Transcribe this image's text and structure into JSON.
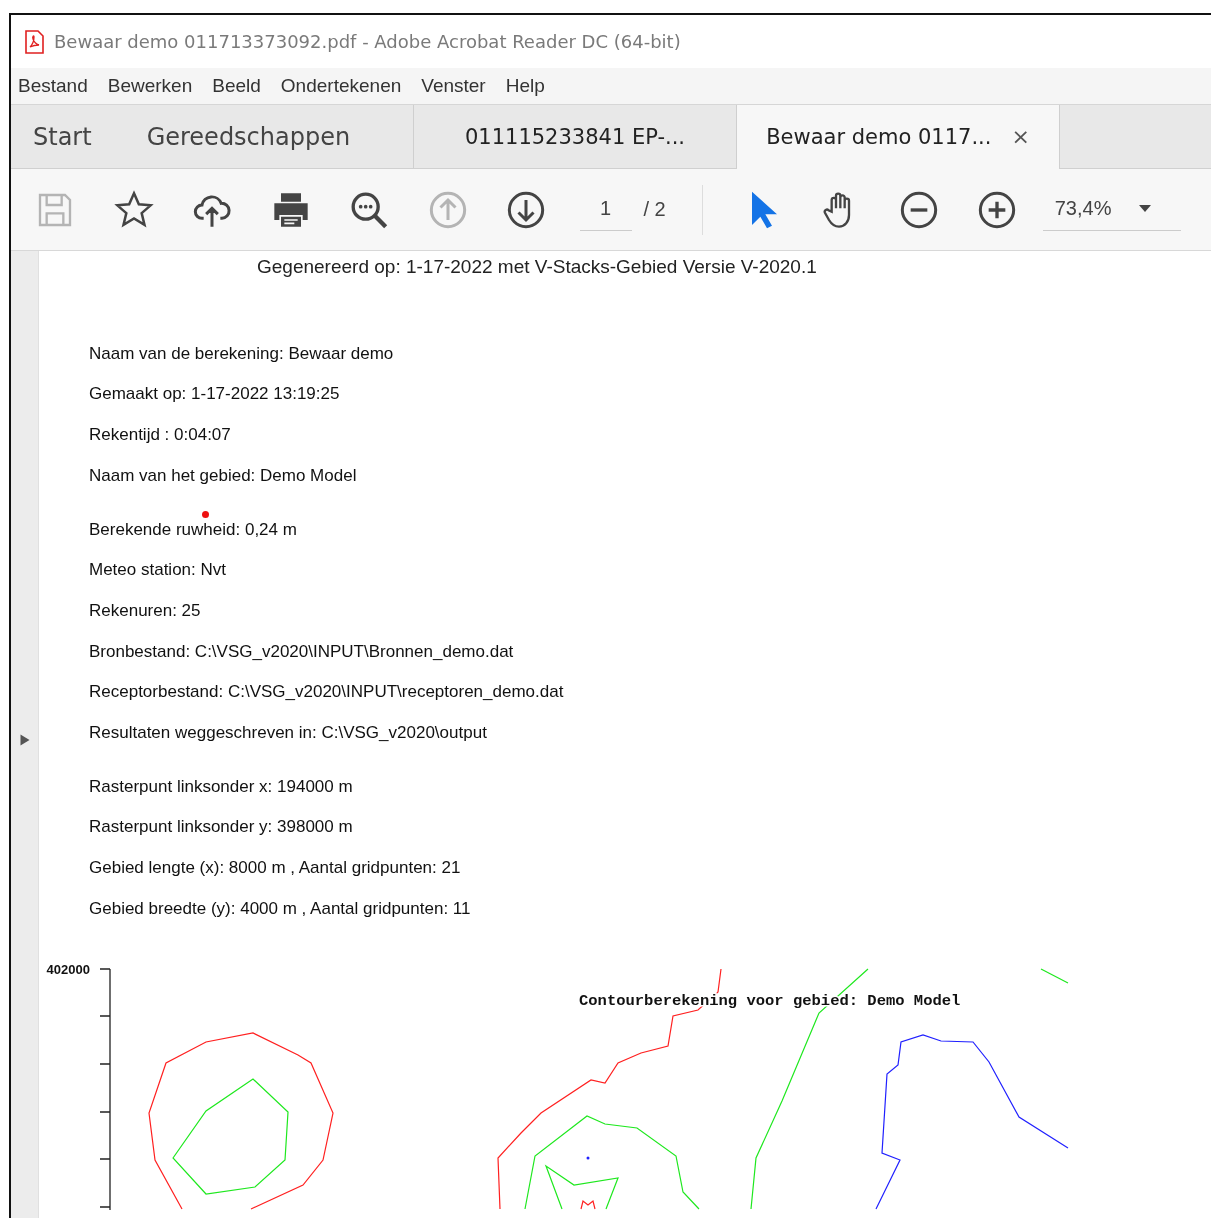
{
  "window": {
    "title": "Bewaar demo 011713373092.pdf - Adobe Acrobat Reader DC (64-bit)"
  },
  "menu": [
    "Bestand",
    "Bewerken",
    "Beeld",
    "Ondertekenen",
    "Venster",
    "Help"
  ],
  "home_tabs": [
    {
      "label": "Start",
      "selected": false
    },
    {
      "label": "Gereedschappen",
      "selected": false
    }
  ],
  "doc_tabs": [
    {
      "label": "011115233841 EP-...",
      "selected": false
    },
    {
      "label": "Bewaar demo 0117...",
      "selected": true,
      "close": "×"
    }
  ],
  "toolbar": {
    "tools": [
      {
        "kind": "save",
        "disabled": true,
        "selected": false
      },
      {
        "kind": "star",
        "disabled": false,
        "selected": false
      },
      {
        "kind": "upload",
        "disabled": false,
        "selected": false
      },
      {
        "kind": "print",
        "disabled": false,
        "selected": false
      },
      {
        "kind": "search",
        "disabled": false,
        "selected": false
      },
      {
        "kind": "prev",
        "disabled": true,
        "selected": false
      },
      {
        "kind": "next",
        "disabled": false,
        "selected": false
      },
      {
        "kind": "page"
      },
      {
        "kind": "separator"
      },
      {
        "kind": "pointer",
        "disabled": false,
        "selected": true
      },
      {
        "kind": "hand",
        "disabled": false,
        "selected": false
      },
      {
        "kind": "zoom-out",
        "disabled": false,
        "selected": false
      },
      {
        "kind": "zoom-in",
        "disabled": false,
        "selected": false
      },
      {
        "kind": "zoom"
      }
    ],
    "page_number": "1",
    "page_total": "/ 2",
    "zoom": "73,4%"
  },
  "document": {
    "header": "Gegenereerd op:  1-17-2022 met V-Stacks-Gebied Versie V-2020.1",
    "sections": [
      [
        {
          "text": "Naam van de berekening: Bewaar demo",
          "marker": false
        },
        {
          "text": "Gemaakt op: 1-17-2022   13:19:25",
          "marker": false
        },
        {
          "text": "Rekentijd :  0:04:07",
          "marker": false
        },
        {
          "text": "Naam van het gebied: Demo Model",
          "marker": false
        }
      ],
      [
        {
          "text": "Berekende ruwheid: 0,24 m",
          "marker": true
        },
        {
          "text": "Meteo station: Nvt",
          "marker": false
        },
        {
          "text": "Rekenuren: 25",
          "marker": false
        },
        {
          "text": "Bronbestand: C:\\VSG_v2020\\INPUT\\Bronnen_demo.dat",
          "marker": false
        },
        {
          "text": "Receptorbestand: C:\\VSG_v2020\\INPUT\\receptoren_demo.dat",
          "marker": false
        },
        {
          "text": "Resultaten weggeschreven in: C:\\VSG_v2020\\output",
          "marker": false
        }
      ],
      [
        {
          "text": "Rasterpunt linksonder x: 194000 m",
          "marker": false
        },
        {
          "text": "Rasterpunt linksonder y: 398000 m",
          "marker": false
        },
        {
          "text": "Gebied lengte  (x): 8000 m , Aantal gridpunten: 21",
          "marker": false
        },
        {
          "text": "Gebied breedte (y): 4000 m , Aantal gridpunten: 11",
          "marker": false
        }
      ]
    ],
    "plot": {
      "title": "Contourberekening voor gebied: Demo Model",
      "y_label": "402000"
    }
  }
}
